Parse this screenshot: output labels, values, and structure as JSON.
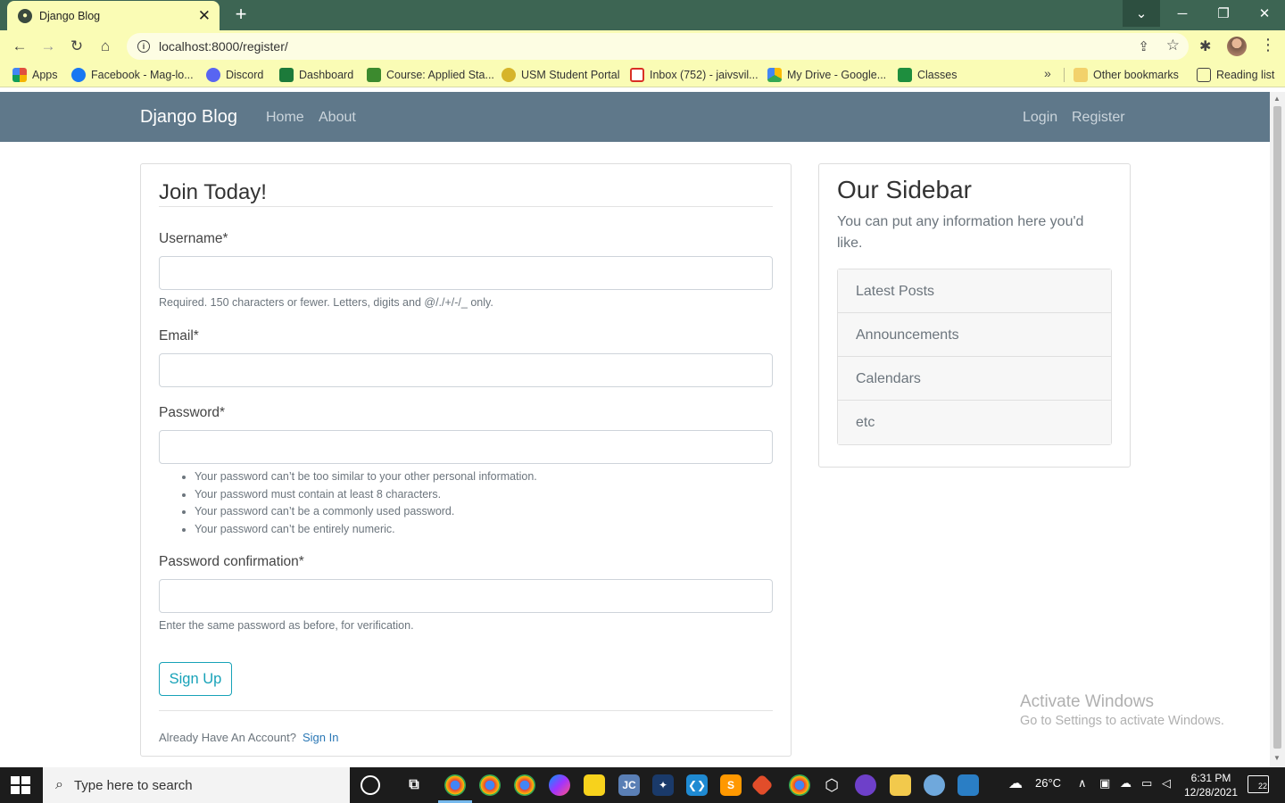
{
  "browser": {
    "tab_title": "Django Blog",
    "url": "localhost:8000/register/",
    "new_tab": "+",
    "tab_close": "✕",
    "bookmarks": [
      {
        "label": "Apps",
        "icon": "apps-grid-icon",
        "color": "#e04f3f"
      },
      {
        "label": "Facebook - Mag-lo...",
        "icon": "facebook-icon",
        "color": "#1877f2"
      },
      {
        "label": "Discord",
        "icon": "discord-icon",
        "color": "#5865f2"
      },
      {
        "label": "Dashboard",
        "icon": "usm-dashboard-icon",
        "color": "#1c7a3a"
      },
      {
        "label": "Course: Applied Sta...",
        "icon": "course-icon",
        "color": "#3c8a2e"
      },
      {
        "label": "USM Student Portal",
        "icon": "usm-portal-icon",
        "color": "#d6b42a"
      },
      {
        "label": "Inbox (752) - jaivsvil...",
        "icon": "gmail-icon",
        "color": "#d93025"
      },
      {
        "label": "My Drive - Google...",
        "icon": "google-drive-icon",
        "color": "#fbbc04"
      },
      {
        "label": "Classes",
        "icon": "google-classroom-icon",
        "color": "#1e8e3e"
      }
    ],
    "other_bookmarks": "Other bookmarks",
    "reading_list": "Reading list"
  },
  "site": {
    "brand": "Django Blog",
    "nav_left": [
      "Home",
      "About"
    ],
    "nav_right": [
      "Login",
      "Register"
    ]
  },
  "form": {
    "legend": "Join Today!",
    "fields": [
      {
        "label": "Username*",
        "help": "Required. 150 characters or fewer. Letters, digits and @/./+/-/_ only."
      },
      {
        "label": "Email*"
      },
      {
        "label": "Password*",
        "help_list": [
          "Your password can’t be too similar to your other personal information.",
          "Your password must contain at least 8 characters.",
          "Your password can’t be a commonly used password.",
          "Your password can’t be entirely numeric."
        ]
      },
      {
        "label": "Password confirmation*",
        "help": "Enter the same password as before, for verification."
      }
    ],
    "submit": "Sign Up",
    "footer_text": "Already Have An Account?",
    "footer_link": "Sign In"
  },
  "sidebar": {
    "title": "Our Sidebar",
    "text": "You can put any information here you'd like.",
    "items": [
      "Latest Posts",
      "Announcements",
      "Calendars",
      "etc"
    ]
  },
  "watermark": {
    "line1": "Activate Windows",
    "line2": "Go to Settings to activate Windows."
  },
  "taskbar": {
    "search_placeholder": "Type here to search",
    "weather": "26°C",
    "time": "6:31 PM",
    "date": "12/28/2021",
    "notifications": "22"
  },
  "colors": {
    "navbar": "#5f788a",
    "accent_btn": "#17a2b8",
    "link": "#2a77b5",
    "browser_frame": "#3d6553",
    "browser_toolbar": "#fafcb5"
  }
}
